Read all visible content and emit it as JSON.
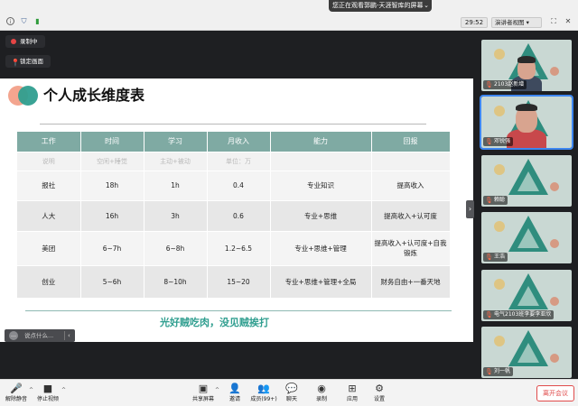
{
  "statusbar": {
    "viewing_banner": "您正在观看郭鹏-天涯智库的屏幕",
    "timer": "29:52",
    "view_mode": "演讲者视图"
  },
  "recording": {
    "rec_label": "录制中",
    "lock_label": "锁定画面"
  },
  "slide": {
    "title": "个人成长维度表",
    "tagline": "光好贼吃肉，没见贼挨打",
    "headers": [
      "工作",
      "时间",
      "学习",
      "月收入",
      "能力",
      "回报"
    ],
    "hint_row": [
      "说明",
      "空闲+睡觉",
      "主动+被动",
      "单位：万",
      "",
      ""
    ],
    "rows": [
      [
        "报社",
        "18h",
        "1h",
        "0.4",
        "专业知识",
        "提高收入"
      ],
      [
        "人大",
        "16h",
        "3h",
        "0.6",
        "专业+思维",
        "提高收入+认可度"
      ],
      [
        "美团",
        "6~7h",
        "6~8h",
        "1.2~6.5",
        "专业+思维+管理",
        "提高收入+认可度+自我锻炼"
      ],
      [
        "创业",
        "5~6h",
        "8~10h",
        "15~20",
        "专业+思维+管理+全局",
        "财务自由+一番天地"
      ]
    ]
  },
  "chat_hint": "说点什么...",
  "participants": [
    {
      "name": "2103赵新增"
    },
    {
      "name": "邓锐强"
    },
    {
      "name": "赖聪"
    },
    {
      "name": "王浩"
    },
    {
      "name": "电气2103班李要李亚欣"
    },
    {
      "name": "刘一帆"
    }
  ],
  "toolbar": {
    "mute": "解除静音",
    "stop_video": "停止视频",
    "share": "共享屏幕",
    "invite": "邀请",
    "members": "成员(99+)",
    "chat": "聊天",
    "record": "录制",
    "apps": "应用",
    "settings": "设置",
    "leave": "离开会议"
  },
  "colors": {
    "accent": "#2f9e8f",
    "header_bg": "#7faaa3",
    "leave": "#e04b4b"
  },
  "icons": [
    "info-icon",
    "shield-icon",
    "signal-icon",
    "fullscreen-icon",
    "close-icon",
    "record-dot-icon",
    "pin-icon",
    "mic-muted-icon",
    "video-icon",
    "share-screen-icon",
    "invite-icon",
    "members-icon",
    "chat-icon",
    "record-icon",
    "apps-icon",
    "settings-icon"
  ]
}
